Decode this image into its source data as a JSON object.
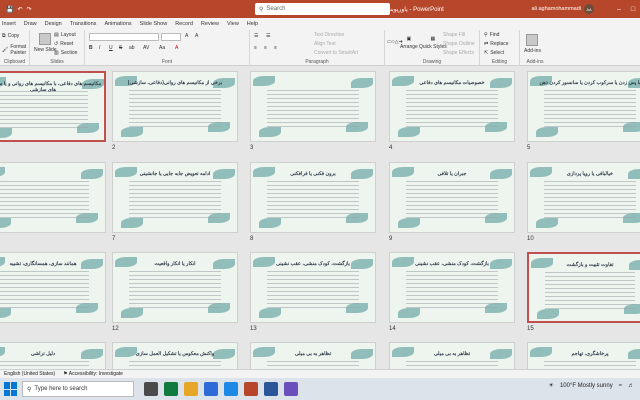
{
  "titlebar": {
    "doc_title": "پاورپوینت سلامت روان - دیپ اسلایدز  -  PowerPoint",
    "search_placeholder": "Search",
    "user_name": "ali aghamohammadi",
    "user_initials": "AA"
  },
  "tabs": [
    "Insert",
    "Draw",
    "Design",
    "Transitions",
    "Animations",
    "Slide Show",
    "Record",
    "Review",
    "View",
    "Help"
  ],
  "ribbon": {
    "clipboard": {
      "label": "Clipboard",
      "copy": "Copy",
      "format_painter": "Format Painter",
      "paste": "Paste"
    },
    "slides": {
      "label": "Slides",
      "new_slide": "New Slide",
      "layout": "Layout",
      "reset": "Reset",
      "section": "Section"
    },
    "font": {
      "label": "Font",
      "size_up": "A",
      "size_down": "A",
      "bold": "B",
      "italic": "I",
      "underline": "U",
      "strike": "S",
      "shadow": "ab",
      "spacing": "AV",
      "case": "Aa",
      "color": "A"
    },
    "paragraph": {
      "label": "Paragraph",
      "text_direction": "Text Direction",
      "align_text": "Align Text",
      "convert_smartart": "Convert to SmartArt"
    },
    "drawing": {
      "label": "Drawing",
      "arrange": "Arrange",
      "quick_styles": "Quick Styles",
      "shape_fill": "Shape Fill",
      "shape_outline": "Shape Outline",
      "shape_effects": "Shape Effects"
    },
    "editing": {
      "label": "Editing",
      "find": "Find",
      "replace": "Replace",
      "select": "Select"
    },
    "addins": {
      "label": "Add-ins",
      "addins": "Add-ins"
    }
  },
  "slides": [
    {
      "num": "",
      "title": "مکانیسم های دفاعی، با مکانیسم های روانی و یا مکانیسم های سازشی",
      "selected": true
    },
    {
      "num": "2",
      "title": "برخی از مکانیسم های روانی(دفاعی، سازشی)",
      "selected": false
    },
    {
      "num": "3",
      "title": "",
      "selected": false
    },
    {
      "num": "4",
      "title": "خصوصیات مکانیسم های دفاعی",
      "selected": false
    },
    {
      "num": "5",
      "title": "با پس زدن یا سرکوب کردن یا سانسور کردن ذهن",
      "selected": false
    },
    {
      "num": "",
      "title": "",
      "selected": false
    },
    {
      "num": "7",
      "title": "ادامه تعویض جابه جایی یا جانشینی",
      "selected": false
    },
    {
      "num": "8",
      "title": "برون فکنی یا فرافکنی",
      "selected": false
    },
    {
      "num": "9",
      "title": "جبران یا تلافی",
      "selected": false
    },
    {
      "num": "10",
      "title": "خیالبافی یا رویا پردازی",
      "selected": false
    },
    {
      "num": "",
      "title": "همانند سازی، همسانگاری، تشبیه",
      "selected": false
    },
    {
      "num": "12",
      "title": "انکار یا انکار واقعیت",
      "selected": false
    },
    {
      "num": "13",
      "title": "بازگشت، کودک منشی، عقب نشینی",
      "selected": false
    },
    {
      "num": "14",
      "title": "بازگشت، کودک منشی، عقب نشینی",
      "selected": false
    },
    {
      "num": "15",
      "title": "تفاوت تثبیت و بازگشت",
      "selected": true
    },
    {
      "num": "",
      "title": "دلیل تراشی",
      "selected": false
    },
    {
      "num": "",
      "title": "واکنش معکوس یا تشکیل العمل سازی",
      "selected": false
    },
    {
      "num": "",
      "title": "تظاهر به بی میلی",
      "selected": false
    },
    {
      "num": "",
      "title": "تظاهر به بی میلی",
      "selected": false
    },
    {
      "num": "",
      "title": "پرخاشگری، تهاجم",
      "selected": false
    }
  ],
  "status": {
    "language": "English (United States)",
    "accessibility": "Accessibility: Investigate"
  },
  "taskbar": {
    "search_placeholder": "Type here to search",
    "weather": "100°F  Mostly sunny"
  },
  "colors": {
    "accent": "#b7472a",
    "selection": "#c0504d"
  }
}
